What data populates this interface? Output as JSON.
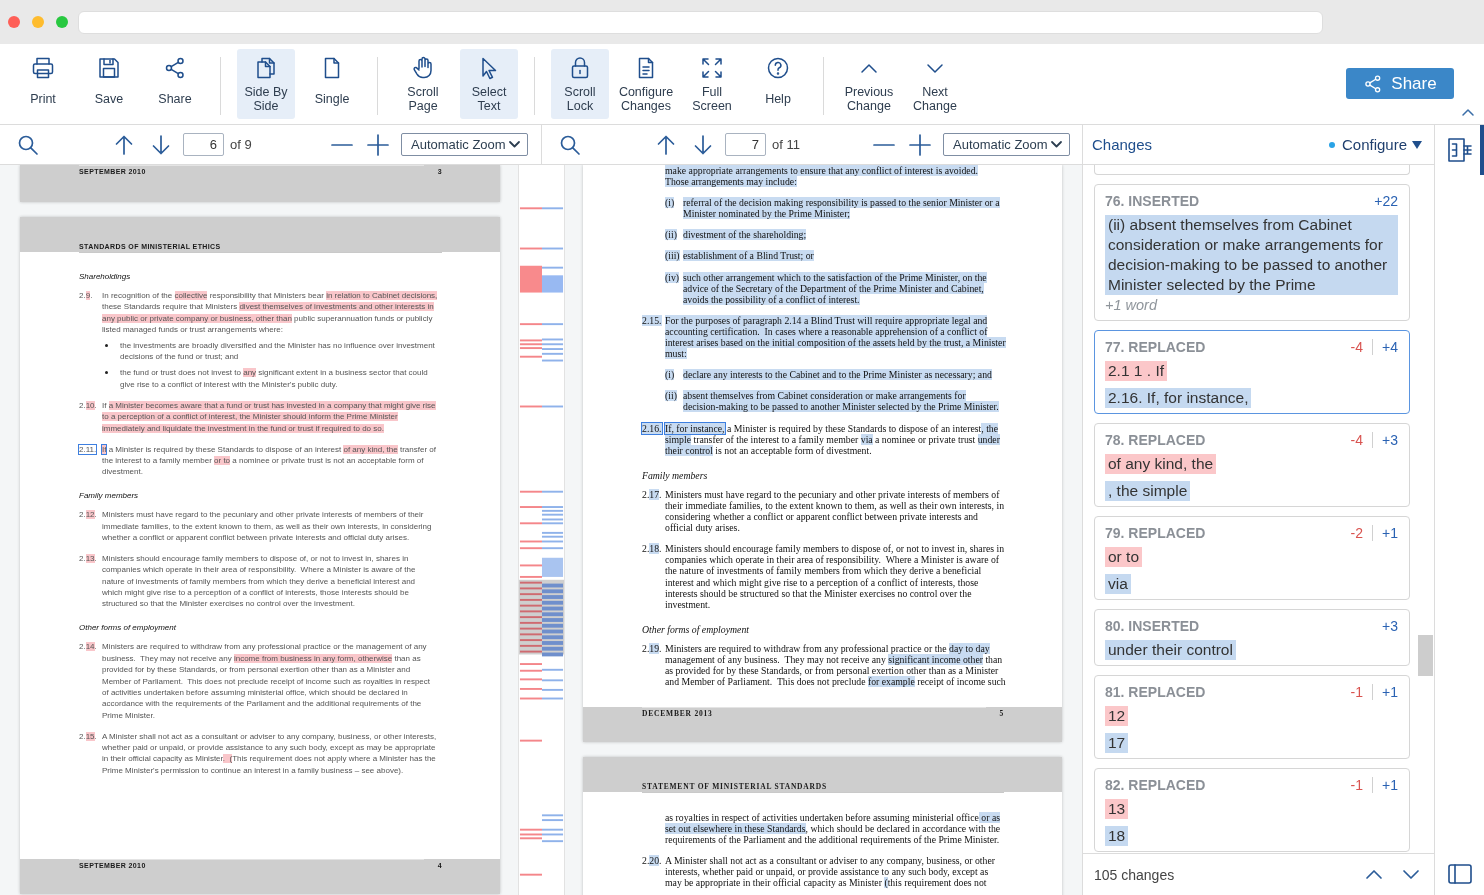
{
  "toolbar": {
    "groups": [
      {
        "buttons": [
          {
            "label": "Print",
            "selected": false
          },
          {
            "label": "Save",
            "selected": false
          },
          {
            "label": "Share",
            "selected": false
          }
        ]
      },
      {
        "buttons": [
          {
            "label": "Side By Side",
            "selected": true
          },
          {
            "label": "Single",
            "selected": false
          }
        ]
      },
      {
        "buttons": [
          {
            "label": "Scroll Page",
            "selected": false
          },
          {
            "label": "Select Text",
            "selected": true
          }
        ]
      },
      {
        "buttons": [
          {
            "label": "Scroll Lock",
            "selected": true
          },
          {
            "label": "Configure Changes",
            "selected": false
          },
          {
            "label": "Full Screen",
            "selected": false
          },
          {
            "label": "Help",
            "selected": false
          }
        ]
      },
      {
        "buttons": [
          {
            "label": "Previous Change",
            "selected": false
          },
          {
            "label": "Next Change",
            "selected": false
          }
        ]
      }
    ],
    "share_button": "Share"
  },
  "panes": [
    {
      "kind": "original",
      "nav": {
        "page": "6",
        "page_count": "of 9",
        "zoom": "Automatic Zoom"
      },
      "pages": [
        {
          "footer": {
            "date": "SEPTEMBER 2010",
            "page": "3"
          }
        },
        {
          "header": "STANDARDS OF MINISTERIAL ETHICS",
          "blocks": [
            {
              "kind": "heading",
              "text": "Shareholdings"
            },
            {
              "kind": "numbered",
              "number": [
                {
                  "text": "2.",
                  "changed": false,
                  "selected": false
                },
                {
                  "text": "9",
                  "changed": true,
                  "selected": false
                },
                {
                  "text": ".",
                  "changed": false,
                  "selected": false
                }
              ],
              "lines": [
                [
                  {
                    "text": "In recognition of the ",
                    "changed": false,
                    "selected": false
                  },
                  {
                    "text": "collective",
                    "changed": true,
                    "selected": false
                  },
                  {
                    "text": " responsibility that Ministers bear ",
                    "changed": false,
                    "selected": false
                  },
                  {
                    "text": "in relation to Cabinet decisions,",
                    "changed": true,
                    "selected": false
                  }
                ],
                [
                  {
                    "text": "these Standards require that Ministers ",
                    "changed": false,
                    "selected": false
                  },
                  {
                    "text": "divest themselves of investments and other interests in",
                    "changed": true,
                    "selected": false
                  }
                ],
                [
                  {
                    "text": "any public or private company or business, other than",
                    "changed": true,
                    "selected": false
                  },
                  {
                    "text": " public superannuation funds or publicly",
                    "changed": false,
                    "selected": false
                  }
                ],
                [
                  {
                    "text": "listed managed funds or trust arrangements where:",
                    "changed": false,
                    "selected": false
                  }
                ]
              ]
            },
            {
              "kind": "bullet",
              "lines": [
                [
                  {
                    "text": "the investments are broadly diversified and the Minister has no influence over investment",
                    "changed": false,
                    "selected": false
                  }
                ],
                [
                  {
                    "text": "decisions of the fund or trust; and",
                    "changed": false,
                    "selected": false
                  }
                ]
              ]
            },
            {
              "kind": "bullet",
              "lines": [
                [
                  {
                    "text": "the fund or trust does not invest to ",
                    "changed": false,
                    "selected": false
                  },
                  {
                    "text": "any",
                    "changed": true,
                    "selected": false
                  },
                  {
                    "text": " significant extent in a business sector that could",
                    "changed": false,
                    "selected": false
                  }
                ],
                [
                  {
                    "text": "give rise to a conflict of interest with the Minister's public duty.",
                    "changed": false,
                    "selected": false
                  }
                ]
              ]
            },
            {
              "kind": "numbered",
              "number": [
                {
                  "text": "2.",
                  "changed": false,
                  "selected": false
                },
                {
                  "text": "10",
                  "changed": true,
                  "selected": false
                },
                {
                  "text": ".",
                  "changed": false,
                  "selected": false
                }
              ],
              "lines": [
                [
                  {
                    "text": "If ",
                    "changed": false,
                    "selected": false
                  },
                  {
                    "text": "a Minister becomes aware that a fund or trust has invested in a company that might give rise",
                    "changed": true,
                    "selected": false
                  }
                ],
                [
                  {
                    "text": "to a perception of a conflict of interest, the Minister should inform the Prime Minister",
                    "changed": true,
                    "selected": false
                  }
                ],
                [
                  {
                    "text": "immediately and liquidate the investment in the fund or trust if required to do so.",
                    "changed": true,
                    "selected": false
                  }
                ]
              ]
            },
            {
              "kind": "numbered",
              "number": [
                {
                  "text": "2.11.",
                  "changed": false,
                  "selected": true
                }
              ],
              "lines": [
                [
                  {
                    "text": "If",
                    "changed": true,
                    "selected": true
                  },
                  {
                    "text": " a Minister is required by these Standards to dispose of an interest ",
                    "changed": false,
                    "selected": false
                  },
                  {
                    "text": "of any kind, the",
                    "changed": true,
                    "selected": false
                  },
                  {
                    "text": " transfer of",
                    "changed": false,
                    "selected": false
                  }
                ],
                [
                  {
                    "text": "the interest to a family member ",
                    "changed": false,
                    "selected": false
                  },
                  {
                    "text": "or to",
                    "changed": true,
                    "selected": false
                  },
                  {
                    "text": " a nominee or private trust is not an acceptable form of",
                    "changed": false,
                    "selected": false
                  }
                ],
                [
                  {
                    "text": "divestment.",
                    "changed": false,
                    "selected": false
                  }
                ]
              ]
            },
            {
              "kind": "heading",
              "text": "Family members"
            },
            {
              "kind": "numbered",
              "number": [
                {
                  "text": "2.",
                  "changed": false,
                  "selected": false
                },
                {
                  "text": "12",
                  "changed": true,
                  "selected": false
                },
                {
                  "text": ".",
                  "changed": false,
                  "selected": false
                }
              ],
              "lines": [
                [
                  {
                    "text": "Ministers must have regard to the pecuniary and other private interests of members of their",
                    "changed": false,
                    "selected": false
                  }
                ],
                [
                  {
                    "text": "immediate families, to the extent known to them, as well as their own interests, in considering",
                    "changed": false,
                    "selected": false
                  }
                ],
                [
                  {
                    "text": "whether a conflict or apparent conflict between private interests and official duty arises.",
                    "changed": false,
                    "selected": false
                  }
                ]
              ]
            },
            {
              "kind": "numbered",
              "number": [
                {
                  "text": "2.",
                  "changed": false,
                  "selected": false
                },
                {
                  "text": "13",
                  "changed": true,
                  "selected": false
                },
                {
                  "text": ".",
                  "changed": false,
                  "selected": false
                }
              ],
              "lines": [
                [
                  {
                    "text": "Ministers should encourage family members to dispose of, or not to invest in, shares in",
                    "changed": false,
                    "selected": false
                  }
                ],
                [
                  {
                    "text": "companies which operate in their area of responsibility.  Where a Minister is aware of the",
                    "changed": false,
                    "selected": false
                  }
                ],
                [
                  {
                    "text": "nature of investments of family members from which they derive a beneficial interest and",
                    "changed": false,
                    "selected": false
                  }
                ],
                [
                  {
                    "text": "which might give rise to a perception of a conflict of interests, those interests should be",
                    "changed": false,
                    "selected": false
                  }
                ],
                [
                  {
                    "text": "structured so that the Minister exercises no control over the investment.",
                    "changed": false,
                    "selected": false
                  }
                ]
              ]
            },
            {
              "kind": "heading",
              "text": "Other forms of employment"
            },
            {
              "kind": "numbered",
              "number": [
                {
                  "text": "2.",
                  "changed": false,
                  "selected": false
                },
                {
                  "text": "14",
                  "changed": true,
                  "selected": false
                },
                {
                  "text": ".",
                  "changed": false,
                  "selected": false
                }
              ],
              "lines": [
                [
                  {
                    "text": "Ministers are required to withdraw from any professional practice or the management of any",
                    "changed": false,
                    "selected": false
                  }
                ],
                [
                  {
                    "text": "business.  They may not receive any ",
                    "changed": false,
                    "selected": false
                  },
                  {
                    "text": "income from business in any form, otherwise",
                    "changed": true,
                    "selected": false
                  },
                  {
                    "text": " than as",
                    "changed": false,
                    "selected": false
                  }
                ],
                [
                  {
                    "text": "provided for by these Standards, or from personal exertion other than as a Minister and",
                    "changed": false,
                    "selected": false
                  }
                ],
                [
                  {
                    "text": "Member of Parliament.  This does not preclude receipt of income such as royalties in respect",
                    "changed": false,
                    "selected": false
                  }
                ],
                [
                  {
                    "text": "of activities undertaken before assuming ministerial office, which should be declared in",
                    "changed": false,
                    "selected": false
                  }
                ],
                [
                  {
                    "text": "accordance with the requirements of the Parliament and the additional requirements of the",
                    "changed": false,
                    "selected": false
                  }
                ],
                [
                  {
                    "text": "Prime Minister.",
                    "changed": false,
                    "selected": false
                  }
                ]
              ]
            },
            {
              "kind": "numbered",
              "number": [
                {
                  "text": "2.",
                  "changed": false,
                  "selected": false
                },
                {
                  "text": "15",
                  "changed": true,
                  "selected": false
                },
                {
                  "text": ".",
                  "changed": false,
                  "selected": false
                }
              ],
              "lines": [
                [
                  {
                    "text": "A Minister shall not act as a consultant or adviser to any company, business, or other interests,",
                    "changed": false,
                    "selected": false
                  }
                ],
                [
                  {
                    "text": "whether paid or unpaid, or provide assistance to any such body, except as may be appropriate",
                    "changed": false,
                    "selected": false
                  }
                ],
                [
                  {
                    "text": "in their official capacity as Minister",
                    "changed": false,
                    "selected": false
                  },
                  {
                    "text": ".  (",
                    "changed": true,
                    "selected": false
                  },
                  {
                    "text": "This requirement does not apply where a Minister has the",
                    "changed": false,
                    "selected": false
                  }
                ],
                [
                  {
                    "text": "Prime Minister's permission to continue an interest in a family business – see above).",
                    "changed": false,
                    "selected": false
                  }
                ]
              ]
            }
          ],
          "footer": {
            "date": "SEPTEMBER 2010",
            "page": "4"
          }
        }
      ]
    },
    {
      "kind": "revised",
      "nav": {
        "page": "7",
        "page_count": "of 11",
        "zoom": "Automatic Zoom"
      },
      "pages": [
        {
          "blocks": [
            {
              "kind": "continuation",
              "lines": [
                [
                  {
                    "text": "make appropriate arrangements to ensure that any conflict of interest is avoided.",
                    "changed": true,
                    "selected": false
                  }
                ],
                [
                  {
                    "text": "Those arrangements may include:",
                    "changed": true,
                    "selected": false
                  }
                ]
              ]
            },
            {
              "kind": "item",
              "label": [
                {
                  "text": "(i)",
                  "changed": true,
                  "selected": false
                }
              ],
              "lines": [
                [
                  {
                    "text": "referral of the decision making responsibility is passed to the senior Minister or a",
                    "changed": true,
                    "selected": false
                  }
                ],
                [
                  {
                    "text": "Minister nominated by the Prime Minister;",
                    "changed": true,
                    "selected": false
                  }
                ]
              ]
            },
            {
              "kind": "item",
              "label": [
                {
                  "text": "(ii)",
                  "changed": true,
                  "selected": false
                }
              ],
              "lines": [
                [
                  {
                    "text": "divestment of the shareholding;",
                    "changed": true,
                    "selected": false
                  }
                ]
              ]
            },
            {
              "kind": "item",
              "label": [
                {
                  "text": "(iii)",
                  "changed": true,
                  "selected": false
                }
              ],
              "lines": [
                [
                  {
                    "text": "establishment of a Blind Trust; or",
                    "changed": true,
                    "selected": false
                  }
                ]
              ]
            },
            {
              "kind": "item",
              "label": [
                {
                  "text": "(iv)",
                  "changed": true,
                  "selected": false
                }
              ],
              "lines": [
                [
                  {
                    "text": "such other arrangement which to the satisfaction of the Prime Minister, on the",
                    "changed": true,
                    "selected": false
                  }
                ],
                [
                  {
                    "text": "advice of the Secretary of the Department of the Prime Minister and Cabinet,",
                    "changed": true,
                    "selected": false
                  }
                ],
                [
                  {
                    "text": "avoids the possibility of a conflict of interest.",
                    "changed": true,
                    "selected": false
                  }
                ]
              ]
            },
            {
              "kind": "numbered",
              "number": [
                {
                  "text": "2.15.",
                  "changed": true,
                  "selected": false
                }
              ],
              "lines": [
                [
                  {
                    "text": "For the purposes of paragraph 2.14 a Blind Trust will require appropriate legal and",
                    "changed": true,
                    "selected": false
                  }
                ],
                [
                  {
                    "text": "accounting certification.  In cases where a reasonable apprehension of a conflict of",
                    "changed": true,
                    "selected": false
                  }
                ],
                [
                  {
                    "text": "interest arises based on the initial composition of the assets held by the trust, a Minister",
                    "changed": true,
                    "selected": false
                  }
                ],
                [
                  {
                    "text": "must:",
                    "changed": true,
                    "selected": false
                  }
                ]
              ]
            },
            {
              "kind": "item",
              "label": [
                {
                  "text": "(i)",
                  "changed": true,
                  "selected": false
                }
              ],
              "lines": [
                [
                  {
                    "text": "declare any interests to the Cabinet and to the Prime Minister as necessary; and",
                    "changed": true,
                    "selected": false
                  }
                ]
              ]
            },
            {
              "kind": "item",
              "label": [
                {
                  "text": "(ii)",
                  "changed": true,
                  "selected": false
                }
              ],
              "lines": [
                [
                  {
                    "text": "absent themselves from Cabinet consideration or make arrangements for",
                    "changed": true,
                    "selected": false
                  }
                ],
                [
                  {
                    "text": "decision-making to be passed to another Minister selected by the Prime Minister.",
                    "changed": true,
                    "selected": false
                  }
                ]
              ]
            },
            {
              "kind": "numbered",
              "number": [
                {
                  "text": "2.16.",
                  "changed": true,
                  "selected": true
                }
              ],
              "lines": [
                [
                  {
                    "text": "If, for instance,",
                    "changed": true,
                    "selected": true
                  },
                  {
                    "text": " a Minister is required by these Standards to dispose of an interest",
                    "changed": false,
                    "selected": false
                  },
                  {
                    "text": ", the",
                    "changed": true,
                    "selected": false
                  }
                ],
                [
                  {
                    "text": "simple",
                    "changed": true,
                    "selected": false
                  },
                  {
                    "text": " transfer of the interest to a family member ",
                    "changed": false,
                    "selected": false
                  },
                  {
                    "text": "via",
                    "changed": true,
                    "selected": false
                  },
                  {
                    "text": " a nominee or private trust ",
                    "changed": false,
                    "selected": false
                  },
                  {
                    "text": "under",
                    "changed": true,
                    "selected": false
                  }
                ],
                [
                  {
                    "text": "their control",
                    "changed": true,
                    "selected": false
                  },
                  {
                    "text": " is not an acceptable form of divestment.",
                    "changed": false,
                    "selected": false
                  }
                ]
              ]
            },
            {
              "kind": "heading",
              "text": "Family members"
            },
            {
              "kind": "numbered",
              "number": [
                {
                  "text": "2.",
                  "changed": false,
                  "selected": false
                },
                {
                  "text": "17",
                  "changed": true,
                  "selected": false
                },
                {
                  "text": ".",
                  "changed": false,
                  "selected": false
                }
              ],
              "lines": [
                [
                  {
                    "text": "Ministers must have regard to the pecuniary and other private interests of members of",
                    "changed": false,
                    "selected": false
                  }
                ],
                [
                  {
                    "text": "their immediate families, to the extent known to them, as well as their own interests, in",
                    "changed": false,
                    "selected": false
                  }
                ],
                [
                  {
                    "text": "considering whether a conflict or apparent conflict between private interests and",
                    "changed": false,
                    "selected": false
                  }
                ],
                [
                  {
                    "text": "official duty arises.",
                    "changed": false,
                    "selected": false
                  }
                ]
              ]
            },
            {
              "kind": "numbered",
              "number": [
                {
                  "text": "2.",
                  "changed": false,
                  "selected": false
                },
                {
                  "text": "18",
                  "changed": true,
                  "selected": false
                },
                {
                  "text": ".",
                  "changed": false,
                  "selected": false
                }
              ],
              "lines": [
                [
                  {
                    "text": "Ministers should encourage family members to dispose of, or not to invest in, shares in",
                    "changed": false,
                    "selected": false
                  }
                ],
                [
                  {
                    "text": "companies which operate in their area of responsibility.  Where a Minister is aware of",
                    "changed": false,
                    "selected": false
                  }
                ],
                [
                  {
                    "text": "the nature of investments of family members from which they derive a beneficial",
                    "changed": false,
                    "selected": false
                  }
                ],
                [
                  {
                    "text": "interest and which might give rise to a perception of a conflict of interests, those",
                    "changed": false,
                    "selected": false
                  }
                ],
                [
                  {
                    "text": "interests should be structured so that the Minister exercises no control over the",
                    "changed": false,
                    "selected": false
                  }
                ],
                [
                  {
                    "text": "investment.",
                    "changed": false,
                    "selected": false
                  }
                ]
              ]
            },
            {
              "kind": "heading",
              "text": "Other forms of employment"
            },
            {
              "kind": "numbered",
              "number": [
                {
                  "text": "2.",
                  "changed": false,
                  "selected": false
                },
                {
                  "text": "19",
                  "changed": true,
                  "selected": false
                },
                {
                  "text": ".",
                  "changed": false,
                  "selected": false
                }
              ],
              "lines": [
                [
                  {
                    "text": "Ministers are required to withdraw from any professional practice or the ",
                    "changed": false,
                    "selected": false
                  },
                  {
                    "text": "day to day",
                    "changed": true,
                    "selected": false
                  }
                ],
                [
                  {
                    "text": "management of any business.  They may not receive any ",
                    "changed": false,
                    "selected": false
                  },
                  {
                    "text": "significant income other",
                    "changed": true,
                    "selected": false
                  },
                  {
                    "text": " than",
                    "changed": false,
                    "selected": false
                  }
                ],
                [
                  {
                    "text": "as provided for by these Standards, or from personal exertion other than as a Minister",
                    "changed": false,
                    "selected": false
                  }
                ],
                [
                  {
                    "text": "and Member of Parliament.  This does not preclude ",
                    "changed": false,
                    "selected": false
                  },
                  {
                    "text": "for example",
                    "changed": true,
                    "selected": false
                  },
                  {
                    "text": " receipt of income such",
                    "changed": false,
                    "selected": false
                  }
                ]
              ]
            }
          ],
          "footer": {
            "date": "DECEMBER 2013",
            "page": "5"
          }
        },
        {
          "header": "STATEMENT OF MINISTERIAL STANDARDS",
          "blocks": [
            {
              "kind": "continuation",
              "lines": [
                [
                  {
                    "text": "as royalties in respect of activities undertaken before assuming ministerial office",
                    "changed": false,
                    "selected": false
                  },
                  {
                    "text": " or as",
                    "changed": true,
                    "selected": false
                  }
                ],
                [
                  {
                    "text": "set out elsewhere in these Standards",
                    "changed": true,
                    "selected": false
                  },
                  {
                    "text": ", which should be declared in accordance with the",
                    "changed": false,
                    "selected": false
                  }
                ],
                [
                  {
                    "text": "requirements of the Parliament and the additional requirements of the Prime Minister.",
                    "changed": false,
                    "selected": false
                  }
                ]
              ]
            },
            {
              "kind": "numbered",
              "number": [
                {
                  "text": "2.",
                  "changed": false,
                  "selected": false
                },
                {
                  "text": "20",
                  "changed": true,
                  "selected": false
                },
                {
                  "text": ".",
                  "changed": false,
                  "selected": false
                }
              ],
              "lines": [
                [
                  {
                    "text": "A Minister shall not act as a consultant or adviser to any company, business, or other",
                    "changed": false,
                    "selected": false
                  }
                ],
                [
                  {
                    "text": "interests, whether paid or unpaid, or provide assistance to any such body, except as",
                    "changed": false,
                    "selected": false
                  }
                ],
                [
                  {
                    "text": "may be appropriate in their official capacity as Minister ",
                    "changed": false,
                    "selected": false
                  },
                  {
                    "text": "(",
                    "changed": true,
                    "selected": false
                  },
                  {
                    "text": "this requirement does not",
                    "changed": false,
                    "selected": false
                  }
                ]
              ]
            }
          ]
        }
      ]
    }
  ],
  "changes_panel": {
    "title": "Changes",
    "configure": "Configure",
    "cards": [
      {
        "title": "76. INSERTED",
        "kind": "inserted",
        "added": "+22",
        "inserted": "(ii) absent themselves from Cabinet consideration or make arrangements for decision-making to be passed to another Minister selected by the Prime",
        "more": "+1 word",
        "selected": false
      },
      {
        "title": "77. REPLACED",
        "kind": "replaced",
        "removed": "-4",
        "added": "+4",
        "deleted": "2.1 1 . If",
        "inserted": "2.16. If, for instance,",
        "selected": true
      },
      {
        "title": "78. REPLACED",
        "kind": "replaced",
        "removed": "-4",
        "added": "+3",
        "deleted": "of any kind, the",
        "inserted": ", the simple",
        "selected": false
      },
      {
        "title": "79. REPLACED",
        "kind": "replaced",
        "removed": "-2",
        "added": "+1",
        "deleted": "or to",
        "inserted": "via",
        "selected": false
      },
      {
        "title": "80. INSERTED",
        "kind": "inserted",
        "added": "+3",
        "inserted": "under their control",
        "selected": false
      },
      {
        "title": "81. REPLACED",
        "kind": "replaced",
        "removed": "-1",
        "added": "+1",
        "deleted": "12",
        "inserted": "17",
        "selected": false
      },
      {
        "title": "82. REPLACED",
        "kind": "replaced",
        "removed": "-1",
        "added": "+1",
        "deleted": "13",
        "inserted": "18",
        "selected": false
      }
    ],
    "count": "105 changes"
  },
  "side_rail": [
    {
      "selected": true
    },
    {
      "selected": false
    }
  ]
}
